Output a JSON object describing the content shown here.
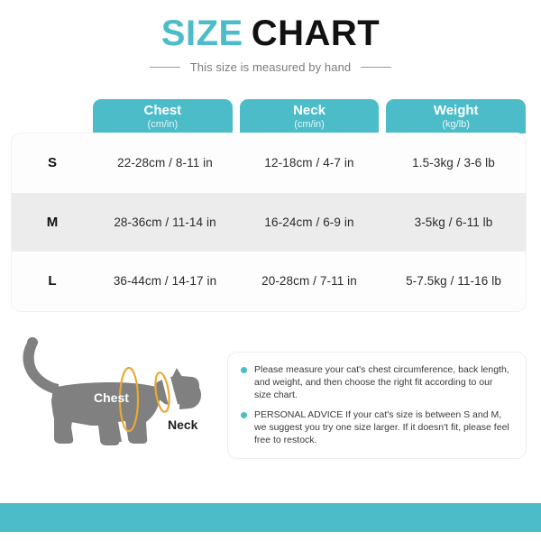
{
  "header": {
    "title_part1": "SIZE",
    "title_part2": "CHART",
    "subtitle": "This size is measured by hand"
  },
  "table": {
    "columns": [
      {
        "title": "Chest",
        "unit": "(cm/in)"
      },
      {
        "title": "Neck",
        "unit": "(cm/in)"
      },
      {
        "title": "Weight",
        "unit": "(kg/lb)"
      }
    ],
    "rows": [
      {
        "size": "S",
        "chest": "22-28cm / 8-11 in",
        "neck": "12-18cm / 4-7 in",
        "weight": "1.5-3kg / 3-6 lb"
      },
      {
        "size": "M",
        "chest": "28-36cm / 11-14 in",
        "neck": "16-24cm / 6-9 in",
        "weight": "3-5kg / 6-11 lb"
      },
      {
        "size": "L",
        "chest": "36-44cm / 14-17 in",
        "neck": "20-28cm / 7-11 in",
        "weight": "5-7.5kg / 11-16 lb"
      }
    ]
  },
  "illustration": {
    "chest_label": "Chest",
    "neck_label": "Neck"
  },
  "notes": [
    "Please measure your cat's chest circumference, back length, and weight, and then choose the right fit according to our size chart.",
    "PERSONAL ADVICE If your cat's size is between S and M, we suggest you try one size larger. If it doesn't fit, please feel free to restock."
  ],
  "colors": {
    "accent": "#4bbcc8",
    "alt_row": "#ececec",
    "cat_gray": "#808080",
    "measure_line": "#e8a838"
  }
}
